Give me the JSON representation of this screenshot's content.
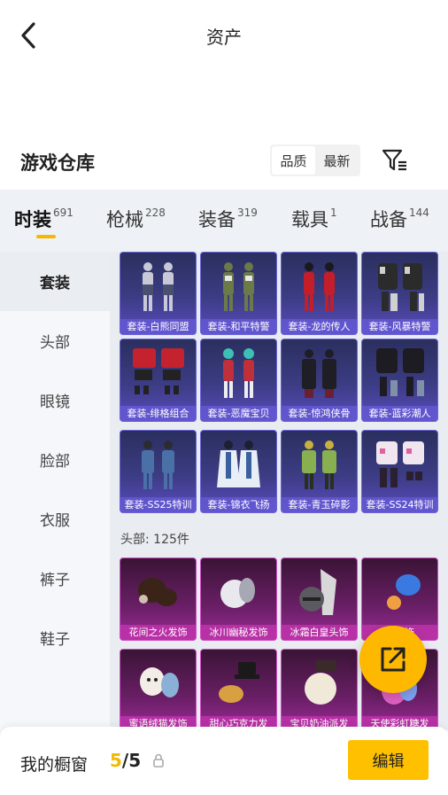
{
  "header": {
    "title": "资产"
  },
  "section": {
    "title": "游戏仓库",
    "sort_options": [
      "品质",
      "最新"
    ]
  },
  "tabs": [
    {
      "label": "时装",
      "count": "691"
    },
    {
      "label": "枪械",
      "count": "228"
    },
    {
      "label": "装备",
      "count": "319"
    },
    {
      "label": "载具",
      "count": "1"
    },
    {
      "label": "战备",
      "count": "144"
    }
  ],
  "sidebar": {
    "items": [
      "套装",
      "头部",
      "眼镜",
      "脸部",
      "衣服",
      "裤子",
      "鞋子"
    ]
  },
  "outfits": [
    "套装-白熊同盟",
    "套装-和平特警",
    "套装-龙的传人",
    "套装-风暴特警",
    "套装-绯格组合",
    "套装-恶魔宝贝",
    "套装-惊鸿侠骨",
    "套装-蓝彩潮人",
    "套装-SS25特训",
    "套装-锦衣飞扬",
    "套装-青玉碎影",
    "套装-SS24特训"
  ],
  "head_section": {
    "title": "头部: 125件",
    "items": [
      "花间之火发饰",
      "冰川幽秘发饰",
      "冰霜白皇头饰",
      "",
      "",
      "",
      "",
      ""
    ],
    "items_partial": [
      "花间之火发饰",
      "冰川幽秘发饰",
      "冰霜白皇头饰",
      "…发饰",
      "蜜语绒猫发饰",
      "甜心巧克力发",
      "宝贝奶油派发",
      "天使彩虹糖发"
    ]
  },
  "bottom_bar": {
    "label": "我的橱窗",
    "current": "5",
    "separator": "/",
    "total": "5",
    "edit_label": "编辑"
  },
  "colors": {
    "accent": "#f5b800",
    "purple_card": "#3c3c84",
    "pink_card": "#6a1f66"
  }
}
